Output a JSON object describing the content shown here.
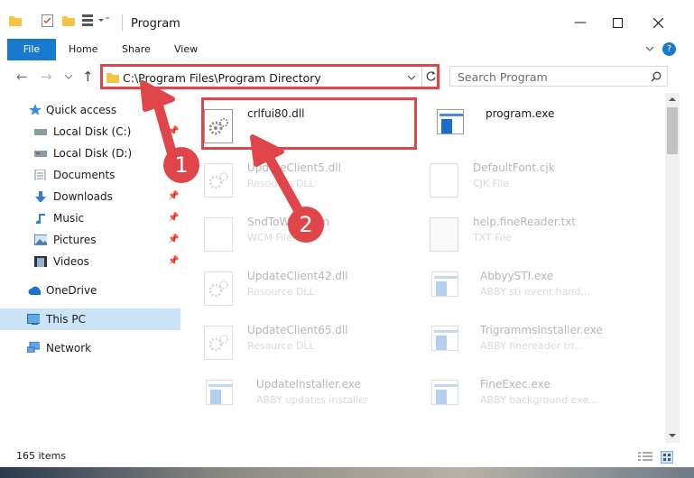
{
  "window": {
    "title": "Program"
  },
  "ribbon": {
    "file": "File",
    "tabs": [
      "Home",
      "Share",
      "View"
    ],
    "help": "?"
  },
  "address": {
    "path": "C:\\Program Files\\Program Directory",
    "search_placeholder": "Search Program"
  },
  "sidebar": [
    {
      "label": "Quick access",
      "icon": "star-icon",
      "pinned": false
    },
    {
      "label": "Local Disk (C:)",
      "icon": "drive-icon",
      "pinned": true
    },
    {
      "label": "Local Disk (D:)",
      "icon": "drive-icon",
      "pinned": false
    },
    {
      "label": "Documents",
      "icon": "documents-icon",
      "pinned": true
    },
    {
      "label": "Downloads",
      "icon": "downloads-icon",
      "pinned": true
    },
    {
      "label": "Music",
      "icon": "music-icon",
      "pinned": true
    },
    {
      "label": "Pictures",
      "icon": "pictures-icon",
      "pinned": true
    },
    {
      "label": "Videos",
      "icon": "videos-icon",
      "pinned": true
    },
    {
      "label": "OneDrive",
      "icon": "onedrive-icon",
      "pinned": false
    },
    {
      "label": "This PC",
      "icon": "this-pc-icon",
      "pinned": false,
      "selected": true
    },
    {
      "label": "Network",
      "icon": "network-icon",
      "pinned": false
    }
  ],
  "files": [
    {
      "name": "crlfui80.dll",
      "type": "",
      "icon": "dll-gear-icon",
      "highlighted": true
    },
    {
      "name": "program.exe",
      "type": "",
      "icon": "exe-icon"
    },
    {
      "name": "UpdateClient5.dll",
      "type": "Resource DLL",
      "icon": "dll-gear-icon"
    },
    {
      "name": "DefaultFont.cjk",
      "type": "CJK File",
      "icon": "blank-file-icon"
    },
    {
      "name": "SndToWo...ecm",
      "type": "WCM File",
      "icon": "blank-file-icon"
    },
    {
      "name": "help.fineReader.txt",
      "type": "TXT File",
      "icon": "text-file-icon"
    },
    {
      "name": "UpdateClient42.dll",
      "type": "Resource DLL",
      "icon": "dll-gear-icon"
    },
    {
      "name": "AbbyySTI.exe",
      "type": "ABBY sti event hand...",
      "icon": "exe-icon"
    },
    {
      "name": "UpdateClient65.dll",
      "type": "Resource DLL",
      "icon": "dll-gear-icon"
    },
    {
      "name": "TrigrammsInstaller.exe",
      "type": "ABBY finereader tri...",
      "icon": "exe-icon"
    },
    {
      "name": "UpdateInstaller.exe",
      "type": "ABBY updates installer",
      "icon": "exe-icon"
    },
    {
      "name": "FineExec.exe",
      "type": "ABBY background exe...",
      "icon": "exe-icon"
    }
  ],
  "status": {
    "count": "165 items"
  },
  "callouts": [
    "1",
    "2"
  ],
  "colors": {
    "accent": "#1979ca",
    "annotation": "#e0454a"
  }
}
